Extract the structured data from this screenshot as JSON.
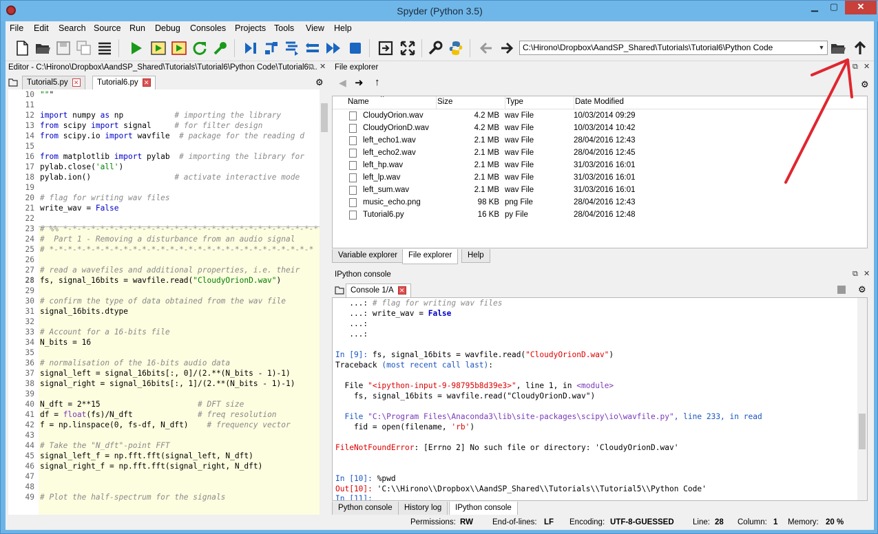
{
  "window": {
    "title": "Spyder (Python 3.5)",
    "min": "▁",
    "max": "▢",
    "close": "✕"
  },
  "menu": [
    "File",
    "Edit",
    "Search",
    "Source",
    "Run",
    "Debug",
    "Consoles",
    "Projects",
    "Tools",
    "View",
    "Help"
  ],
  "toolbar": {
    "path": "C:\\Hirono\\Dropbox\\AandSP_Shared\\Tutorials\\Tutorial6\\Python Code"
  },
  "editor": {
    "header": "Editor - C:\\Hirono\\Dropbox\\AandSP_Shared\\Tutorials\\Tutorial6\\Python Code\\Tutorial6....",
    "tabs": [
      {
        "label": "Tutorial5.py"
      },
      {
        "label": "Tutorial6.py"
      }
    ],
    "lines": [
      {
        "n": "10",
        "t": "\"\"\""
      },
      {
        "n": "11",
        "t": ""
      },
      {
        "n": "12",
        "t": "import numpy as np           # importing the library"
      },
      {
        "n": "13",
        "t": "from scipy import signal     # for filter design"
      },
      {
        "n": "14",
        "t": "from scipy.io import wavfile  # package for the reading d"
      },
      {
        "n": "15",
        "t": ""
      },
      {
        "n": "16",
        "t": "from matplotlib import pylab  # importing the library for"
      },
      {
        "n": "17",
        "t": "pylab.close('all')"
      },
      {
        "n": "18",
        "t": "pylab.ion()                  # activate interactive mode"
      },
      {
        "n": "19",
        "t": ""
      },
      {
        "n": "20",
        "t": "# flag for writing wav files"
      },
      {
        "n": "21",
        "t": "write_wav = False"
      },
      {
        "n": "22",
        "t": ""
      },
      {
        "n": "23",
        "t": "# %% *-*-*-*-*-*-*-*-*-*-*-*-*-*-*-*-*-*-*-*-*-*-*-*-*-*-*-*"
      },
      {
        "n": "24",
        "t": "#  Part 1 - Removing a disturbance from an audio signal"
      },
      {
        "n": "25",
        "t": "# *-*-*-*-*-*-*-*-*-*-*-*-*-*-*-*-*-*-*-*-*-*-*-*-*-*-*-*-*"
      },
      {
        "n": "26",
        "t": ""
      },
      {
        "n": "27",
        "t": "# read a wavefiles and additional properties, i.e. their"
      },
      {
        "n": "28",
        "t": "fs, signal_16bits = wavfile.read(\"CloudyOrionD.wav\")"
      },
      {
        "n": "29",
        "t": ""
      },
      {
        "n": "30",
        "t": "# confirm the type of data obtained from the wav file"
      },
      {
        "n": "31",
        "t": "signal_16bits.dtype"
      },
      {
        "n": "32",
        "t": ""
      },
      {
        "n": "33",
        "t": "# Account for a 16-bits file"
      },
      {
        "n": "34",
        "t": "N_bits = 16"
      },
      {
        "n": "35",
        "t": ""
      },
      {
        "n": "36",
        "t": "# normalisation of the 16-bits audio data"
      },
      {
        "n": "37",
        "t": "signal_left = signal_16bits[:, 0]/(2.**(N_bits - 1)-1)"
      },
      {
        "n": "38",
        "t": "signal_right = signal_16bits[:, 1]/(2.**(N_bits - 1)-1)"
      },
      {
        "n": "39",
        "t": ""
      },
      {
        "n": "40",
        "t": "N_dft = 2**15                     # DFT size"
      },
      {
        "n": "41",
        "t": "df = float(fs)/N_dft              # freq resolution"
      },
      {
        "n": "42",
        "t": "f = np.linspace(0, fs-df, N_dft)    # frequency vector"
      },
      {
        "n": "43",
        "t": ""
      },
      {
        "n": "44",
        "t": "# Take the \"N_dft\"-point FFT"
      },
      {
        "n": "45",
        "t": "signal_left_f = np.fft.fft(signal_left, N_dft)"
      },
      {
        "n": "46",
        "t": "signal_right_f = np.fft.fft(signal_right, N_dft)"
      },
      {
        "n": "47",
        "t": ""
      },
      {
        "n": "48",
        "t": ""
      },
      {
        "n": "49",
        "t": "# Plot the half-spectrum for the signals"
      }
    ]
  },
  "file_explorer": {
    "header": "File explorer",
    "columns": {
      "name": "Name",
      "size": "Size",
      "type": "Type",
      "date": "Date Modified"
    },
    "files": [
      {
        "name": "CloudyOrion.wav",
        "size": "4.2 MB",
        "type": "wav File",
        "date": "10/03/2014 09:29"
      },
      {
        "name": "CloudyOrionD.wav",
        "size": "4.2 MB",
        "type": "wav File",
        "date": "10/03/2014 10:42"
      },
      {
        "name": "left_echo1.wav",
        "size": "2.1 MB",
        "type": "wav File",
        "date": "28/04/2016 12:43"
      },
      {
        "name": "left_echo2.wav",
        "size": "2.1 MB",
        "type": "wav File",
        "date": "28/04/2016 12:45"
      },
      {
        "name": "left_hp.wav",
        "size": "2.1 MB",
        "type": "wav File",
        "date": "31/03/2016 16:01"
      },
      {
        "name": "left_lp.wav",
        "size": "2.1 MB",
        "type": "wav File",
        "date": "31/03/2016 16:01"
      },
      {
        "name": "left_sum.wav",
        "size": "2.1 MB",
        "type": "wav File",
        "date": "31/03/2016 16:01"
      },
      {
        "name": "music_echo.png",
        "size": "98 KB",
        "type": "png File",
        "date": "28/04/2016 12:43"
      },
      {
        "name": "Tutorial6.py",
        "size": "16 KB",
        "type": "py File",
        "date": "28/04/2016 12:48"
      }
    ],
    "tabs": [
      "Variable explorer",
      "File explorer",
      "Help"
    ]
  },
  "console": {
    "header": "IPython console",
    "tab": "Console 1/A",
    "bottom_tabs": [
      "Python console",
      "History log",
      "IPython console"
    ]
  },
  "status": {
    "permissions_label": "Permissions:",
    "permissions": "RW",
    "eol_label": "End-of-lines:",
    "eol": "LF",
    "encoding_label": "Encoding:",
    "encoding": "UTF-8-GUESSED",
    "line_label": "Line:",
    "line": "28",
    "column_label": "Column:",
    "column": "1",
    "memory_label": "Memory:",
    "memory": "20 %"
  },
  "colors": {
    "accent_red": "#e0262f",
    "run_green": "#1a9a1a",
    "titlebar": "#6fb7e9"
  }
}
